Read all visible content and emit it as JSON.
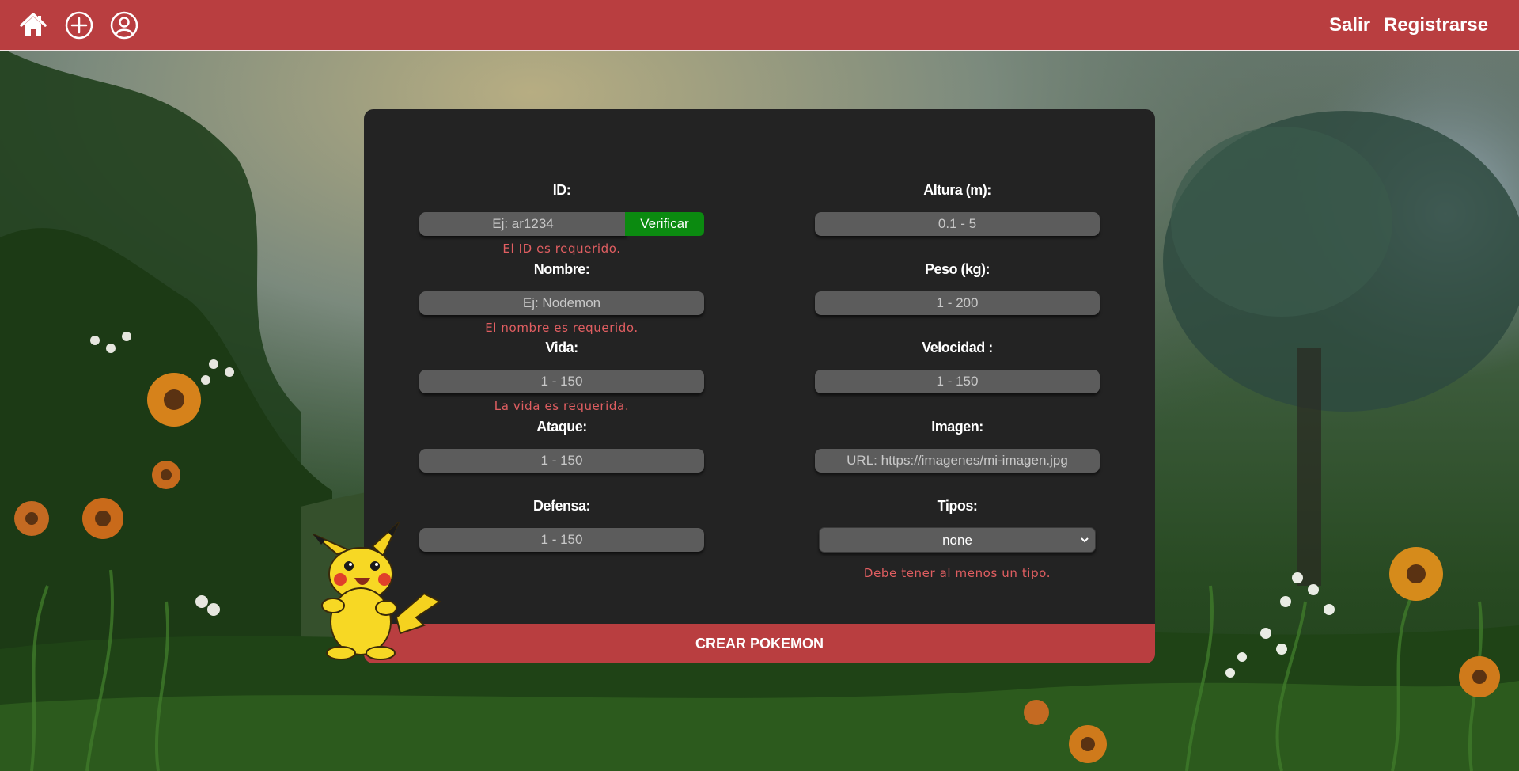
{
  "navbar": {
    "icons": [
      "home-icon",
      "add-circle-icon",
      "user-profile-icon"
    ],
    "links": {
      "logout": "Salir",
      "register": "Registrarse"
    },
    "background_color": "#b93e40"
  },
  "form": {
    "background_color": "#232323",
    "left_column": [
      {
        "key": "id",
        "label": "ID:",
        "placeholder": "Ej: ar1234",
        "value": "",
        "error": "El ID es requerido."
      },
      {
        "key": "name",
        "label": "Nombre:",
        "placeholder": "Ej: Nodemon",
        "value": "",
        "error": "El nombre es requerido."
      },
      {
        "key": "hp",
        "label": "Vida:",
        "placeholder": "1 - 150",
        "value": "",
        "error": "La vida es requerida."
      },
      {
        "key": "attack",
        "label": "Ataque:",
        "placeholder": "1 - 150",
        "value": "",
        "error": ""
      },
      {
        "key": "defense",
        "label": "Defensa:",
        "placeholder": "1 - 150",
        "value": "",
        "error": ""
      }
    ],
    "right_column": [
      {
        "key": "height",
        "label": "Altura (m):",
        "placeholder": "0.1 - 5",
        "value": ""
      },
      {
        "key": "weight",
        "label": "Peso (kg):",
        "placeholder": "1 - 200",
        "value": ""
      },
      {
        "key": "speed",
        "label": "Velocidad :",
        "placeholder": "1 - 150",
        "value": ""
      },
      {
        "key": "image",
        "label": "Imagen:",
        "placeholder": "URL: https://imagenes/mi-imagen.jpg",
        "value": ""
      },
      {
        "key": "types",
        "label": "Tipos:",
        "selected": "none",
        "error": "Debe tener al menos un tipo."
      }
    ],
    "verify_button": "Verificar",
    "verify_color": "#0b8a10",
    "submit_button": "CREAR POKEMON",
    "submit_color": "#b93e40",
    "error_color": "#e05e61"
  },
  "decorations": {
    "mascot": "pikachu-illustration",
    "background": "forest-meadow-scene"
  }
}
